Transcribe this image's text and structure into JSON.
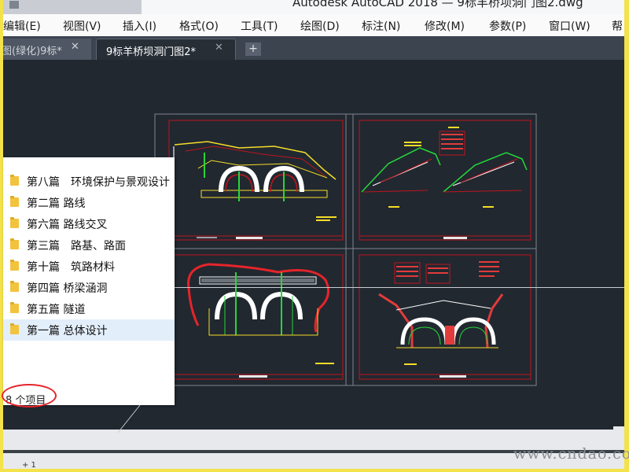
{
  "window": {
    "title": "Autodesk AutoCAD 2018 — 9标羊桥坝洞门图2.dwg"
  },
  "menu": [
    "编辑(E)",
    "视图(V)",
    "插入(I)",
    "格式(O)",
    "工具(T)",
    "绘图(D)",
    "标注(N)",
    "修改(M)",
    "参数(P)",
    "窗口(W)",
    "帮"
  ],
  "tabs": [
    {
      "label": "图(绿化)9标*",
      "close": "✕",
      "active": false
    },
    {
      "label": "9标羊桥坝洞门图2*",
      "close": "✕",
      "active": true
    }
  ],
  "new_tab": "+",
  "explorer": {
    "items": [
      {
        "name": "第八篇　环境保护与景观设计"
      },
      {
        "name": "第二篇 路线"
      },
      {
        "name": "第六篇 路线交叉"
      },
      {
        "name": "第三篇　路基、路面"
      },
      {
        "name": "第十篇　筑路材料"
      },
      {
        "name": "第四篇 桥梁涵洞"
      },
      {
        "name": "第五篇 隧道"
      },
      {
        "name": "第一篇 总体设计",
        "selected": true
      }
    ],
    "count": "8 个项目"
  },
  "watermark": "www.cndao.com",
  "coords": "+ 1",
  "colors": {
    "canvas": "#212830",
    "drawing_border": "#c0141e",
    "annotation": "#f5dd28",
    "accent_green": "#26d63a",
    "highlight_circle": "#e5242a"
  }
}
